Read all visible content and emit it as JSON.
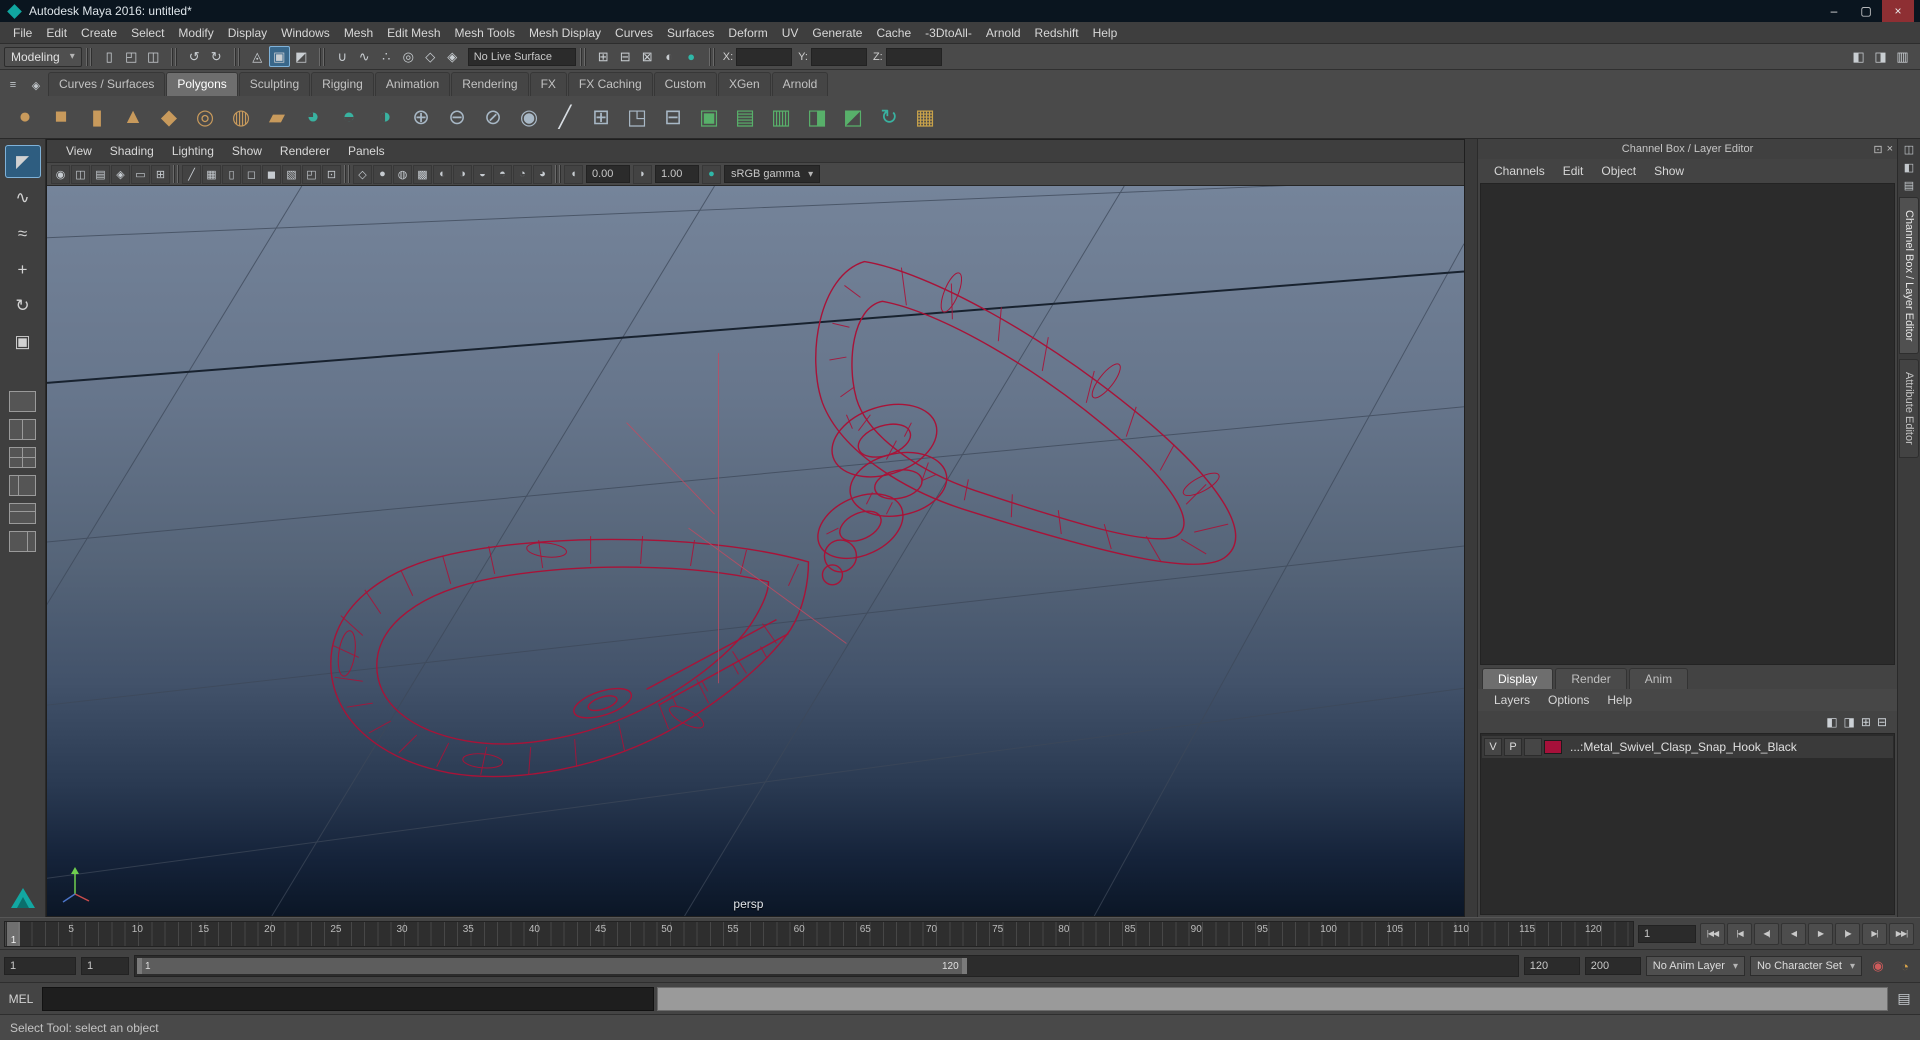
{
  "window": {
    "title": "Autodesk Maya 2016: untitled*",
    "minimize": "–",
    "maximize": "▢",
    "close": "×"
  },
  "menu_bar": {
    "items": [
      "File",
      "Edit",
      "Create",
      "Select",
      "Modify",
      "Display",
      "Windows",
      "Mesh",
      "Edit Mesh",
      "Mesh Tools",
      "Mesh Display",
      "Curves",
      "Surfaces",
      "Deform",
      "UV",
      "Generate",
      "Cache",
      "-3DtoAll-",
      "Arnold",
      "Redshift",
      "Help"
    ]
  },
  "status_line": {
    "mode_selector": "Modeling",
    "live_surface": "No Live Surface",
    "file_icons": [
      {
        "name": "new-scene-icon",
        "glyph": "▯"
      },
      {
        "name": "open-scene-icon",
        "glyph": "◰"
      },
      {
        "name": "save-scene-icon",
        "glyph": "◫"
      }
    ],
    "history_icons": [
      {
        "name": "undo-icon",
        "glyph": "↺"
      },
      {
        "name": "redo-icon",
        "glyph": "↻"
      }
    ],
    "selection_icons": [
      {
        "name": "select-by-hierarchy-icon",
        "glyph": "◬",
        "state": "idle"
      },
      {
        "name": "select-by-object-icon",
        "glyph": "▣",
        "state": "active"
      },
      {
        "name": "select-by-component-icon",
        "glyph": "◩",
        "state": "idle"
      }
    ],
    "snap_icons": [
      {
        "name": "snap-to-grid-icon",
        "glyph": "∪",
        "state": "idle"
      },
      {
        "name": "snap-to-curve-icon",
        "glyph": "∿",
        "state": "idle"
      },
      {
        "name": "snap-to-point-icon",
        "glyph": "∴",
        "state": "idle"
      },
      {
        "name": "snap-to-projected-center-icon",
        "glyph": "◎",
        "state": "idle"
      },
      {
        "name": "snap-to-view-plane-icon",
        "glyph": "◇",
        "state": "idle"
      },
      {
        "name": "make-object-live-icon",
        "glyph": "◈",
        "state": "idle"
      }
    ],
    "render_icons": [
      {
        "name": "open-render-view-icon",
        "glyph": "⊞"
      },
      {
        "name": "render-current-frame-icon",
        "glyph": "⊟"
      },
      {
        "name": "ipr-render-icon",
        "glyph": "⊠"
      },
      {
        "name": "render-settings-icon",
        "glyph": "◐"
      },
      {
        "name": "hypershade-icon",
        "glyph": "●",
        "color": "#2fb8a8"
      }
    ],
    "coord_fields": [
      {
        "label": "X:",
        "value": ""
      },
      {
        "label": "Y:",
        "value": ""
      },
      {
        "label": "Z:",
        "value": ""
      }
    ],
    "sidebar_icons": [
      {
        "name": "show-modeling-toolkit-icon",
        "glyph": "◧"
      },
      {
        "name": "show-hypershade-icon",
        "glyph": "◨"
      },
      {
        "name": "show-attribute-editor-icon",
        "glyph": "▥"
      }
    ]
  },
  "shelf": {
    "side_icons": [
      {
        "name": "shelf-tabs-toggle-icon",
        "glyph": "≡"
      },
      {
        "name": "shelf-menu-icon",
        "glyph": "◈"
      }
    ],
    "tabs": [
      {
        "label": "Curves / Surfaces",
        "state": "idle"
      },
      {
        "label": "Polygons",
        "state": "active"
      },
      {
        "label": "Sculpting",
        "state": "idle"
      },
      {
        "label": "Rigging",
        "state": "idle"
      },
      {
        "label": "Animation",
        "state": "idle"
      },
      {
        "label": "Rendering",
        "state": "idle"
      },
      {
        "label": "FX",
        "state": "idle"
      },
      {
        "label": "FX Caching",
        "state": "idle"
      },
      {
        "label": "Custom",
        "state": "idle"
      },
      {
        "label": "XGen",
        "state": "idle"
      },
      {
        "label": "Arnold",
        "state": "idle"
      }
    ],
    "icons": [
      {
        "name": "poly-sphere-icon",
        "glyph": "●",
        "color": "#c89a5c"
      },
      {
        "name": "poly-cube-icon",
        "glyph": "■",
        "color": "#c89a5c"
      },
      {
        "name": "poly-cylinder-icon",
        "glyph": "▮",
        "color": "#c89a5c"
      },
      {
        "name": "poly-cone-icon",
        "glyph": "▲",
        "color": "#c89a5c"
      },
      {
        "name": "poly-plane-icon",
        "glyph": "◆",
        "color": "#c89a5c"
      },
      {
        "name": "poly-torus-icon",
        "glyph": "◎",
        "color": "#c89a5c"
      },
      {
        "name": "poly-disc-icon",
        "glyph": "◍",
        "color": "#c89a5c"
      },
      {
        "name": "poly-pipe-icon",
        "glyph": "▰",
        "color": "#c89a5c"
      },
      {
        "name": "smooth-mesh-icon",
        "glyph": "◕",
        "color": "#39b2a0"
      },
      {
        "name": "subdiv-proxy-icon",
        "glyph": "◓",
        "color": "#39b2a0"
      },
      {
        "name": "crease-tool-icon",
        "glyph": "◑",
        "color": "#39b2a0"
      },
      {
        "name": "combine-icon",
        "glyph": "⊕",
        "color": "#a8b8c6"
      },
      {
        "name": "separate-icon",
        "glyph": "⊖",
        "color": "#a8b8c6"
      },
      {
        "name": "extract-icon",
        "glyph": "⊘",
        "color": "#a8b8c6"
      },
      {
        "name": "boolean-union-icon",
        "glyph": "◉",
        "color": "#a8b8c6"
      },
      {
        "name": "multi-cut-icon",
        "glyph": "╱",
        "color": "#d8dde2"
      },
      {
        "name": "extrude-icon",
        "glyph": "⊞",
        "color": "#a8b8c6"
      },
      {
        "name": "bevel-icon",
        "glyph": "◳",
        "color": "#a8b8c6"
      },
      {
        "name": "bridge-icon",
        "glyph": "⊟",
        "color": "#a8b8c6"
      },
      {
        "name": "quad-draw-icon",
        "glyph": "▣",
        "color": "#58b06a"
      },
      {
        "name": "target-weld-icon",
        "glyph": "▤",
        "color": "#58b06a"
      },
      {
        "name": "connect-icon",
        "glyph": "▥",
        "color": "#58b06a"
      },
      {
        "name": "mirror-icon",
        "glyph": "◨",
        "color": "#58b06a"
      },
      {
        "name": "sculpt-tool-icon",
        "glyph": "◩",
        "color": "#58b06a"
      },
      {
        "name": "symmetrize-icon",
        "glyph": "↻",
        "color": "#39b2a0"
      },
      {
        "name": "uv-checker-icon",
        "glyph": "▦",
        "color": "#c8a24a"
      }
    ]
  },
  "toolbox": {
    "tools": [
      {
        "name": "select-tool-icon",
        "glyph": "◤",
        "state": "active"
      },
      {
        "name": "lasso-tool-icon",
        "glyph": "∿",
        "state": "idle"
      },
      {
        "name": "paint-select-tool-icon",
        "glyph": "≈",
        "state": "idle"
      },
      {
        "name": "move-tool-icon",
        "glyph": "+",
        "state": "idle"
      },
      {
        "name": "rotate-tool-icon",
        "glyph": "↻",
        "state": "idle"
      },
      {
        "name": "scale-tool-icon",
        "glyph": "▣",
        "state": "idle"
      }
    ],
    "layouts": [
      {
        "name": "single-pane-layout-button",
        "variant": "lo-single"
      },
      {
        "name": "two-pane-layout-button",
        "variant": "lo-two"
      },
      {
        "name": "four-pane-layout-button",
        "variant": "lo-four"
      },
      {
        "name": "persp-outliner-layout-button",
        "variant": "lo-left"
      },
      {
        "name": "persp-graph-layout-button",
        "variant": "lo-top"
      },
      {
        "name": "hypershade-persp-layout-button",
        "variant": "lo-right"
      }
    ]
  },
  "viewport": {
    "menus": [
      "View",
      "Shading",
      "Lighting",
      "Show",
      "Renderer",
      "Panels"
    ],
    "toolbar_group_a": [
      {
        "name": "select-camera-icon",
        "glyph": "◉"
      },
      {
        "name": "lock-camera-icon",
        "glyph": "◫"
      },
      {
        "name": "camera-attributes-icon",
        "glyph": "▤"
      },
      {
        "name": "bookmarks-icon",
        "glyph": "◈"
      },
      {
        "name": "image-plane-icon",
        "glyph": "▭"
      },
      {
        "name": "2d-pan-zoom-icon",
        "glyph": "⊞"
      }
    ],
    "toolbar_group_b": [
      {
        "name": "grease-pencil-icon",
        "glyph": "╱"
      },
      {
        "name": "grid-icon",
        "glyph": "▦"
      },
      {
        "name": "film-gate-icon",
        "glyph": "▯"
      },
      {
        "name": "resolution-gate-icon",
        "glyph": "◻"
      },
      {
        "name": "gate-mask-icon",
        "glyph": "◼"
      },
      {
        "name": "field-chart-icon",
        "glyph": "▧"
      },
      {
        "name": "safe-action-icon",
        "glyph": "◰"
      },
      {
        "name": "safe-title-icon",
        "glyph": "⊡"
      }
    ],
    "toolbar_group_c": [
      {
        "name": "wireframe-icon",
        "glyph": "◇"
      },
      {
        "name": "smooth-shade-all-icon",
        "glyph": "●"
      },
      {
        "name": "wireframe-on-shaded-icon",
        "glyph": "◍"
      },
      {
        "name": "textured-icon",
        "glyph": "▩"
      },
      {
        "name": "use-all-lights-icon",
        "glyph": "◐"
      },
      {
        "name": "shadows-icon",
        "glyph": "◑"
      },
      {
        "name": "screen-space-ao-icon",
        "glyph": "◒"
      },
      {
        "name": "anti-aliasing-icon",
        "glyph": "◓"
      },
      {
        "name": "xray-icon",
        "glyph": "◔"
      },
      {
        "name": "isolate-select-icon",
        "glyph": "◕"
      }
    ],
    "exposure_value": "0.00",
    "gamma_value": "1.00",
    "colorspace": "sRGB gamma",
    "camera_name": "persp",
    "wireframe_color": "#a81338"
  },
  "channel_box": {
    "title": "Channel Box / Layer Editor",
    "header_icons": [
      {
        "name": "pop-out-panel-icon",
        "glyph": "⊡"
      },
      {
        "name": "close-panel-icon",
        "glyph": "×"
      }
    ],
    "menus": [
      "Channels",
      "Edit",
      "Object",
      "Show"
    ],
    "layer_tabs": [
      {
        "label": "Display",
        "state": "active"
      },
      {
        "label": "Render",
        "state": "idle"
      },
      {
        "label": "Anim",
        "state": "idle"
      }
    ],
    "layer_menus": [
      "Layers",
      "Options",
      "Help"
    ],
    "layer_icons": [
      {
        "name": "move-layer-up-icon",
        "glyph": "◧"
      },
      {
        "name": "move-layer-down-icon",
        "glyph": "◨"
      },
      {
        "name": "new-empty-layer-icon",
        "glyph": "⊞"
      },
      {
        "name": "new-layer-from-selected-icon",
        "glyph": "⊟"
      }
    ],
    "layer_row": {
      "visible": "V",
      "playback": "P",
      "color": "#a6103a",
      "name": "...:Metal_Swivel_Clasp_Snap_Hook_Black"
    }
  },
  "side_panel": {
    "icons": [
      {
        "name": "raise-channel-box-icon",
        "glyph": "◫"
      },
      {
        "name": "raise-attribute-editor-icon",
        "glyph": "◧"
      },
      {
        "name": "raise-tool-settings-icon",
        "glyph": "▤"
      }
    ],
    "tabs": [
      {
        "label": "Channel Box / Layer Editor",
        "state": "active"
      },
      {
        "label": "Attribute Editor",
        "state": "idle"
      }
    ]
  },
  "timeline": {
    "ticks": [
      "5",
      "10",
      "15",
      "20",
      "25",
      "30",
      "35",
      "40",
      "45",
      "50",
      "55",
      "60",
      "65",
      "70",
      "75",
      "80",
      "85",
      "90",
      "95",
      "100",
      "105",
      "110",
      "115",
      "120"
    ],
    "current_frame_marker": "1",
    "current_time": "1",
    "playback": [
      {
        "name": "go-to-start-button",
        "glyph": "|◀◀"
      },
      {
        "name": "step-back-frame-button",
        "glyph": "|◀"
      },
      {
        "name": "step-back-key-button",
        "glyph": "◀|"
      },
      {
        "name": "play-backwards-button",
        "glyph": "◀"
      },
      {
        "name": "play-forwards-button",
        "glyph": "▶"
      },
      {
        "name": "step-forward-key-button",
        "glyph": "|▶"
      },
      {
        "name": "step-forward-frame-button",
        "glyph": "▶|"
      },
      {
        "name": "go-to-end-button",
        "glyph": "▶▶|"
      }
    ]
  },
  "range_slider": {
    "animation_start": "1",
    "playback_start": "1",
    "bar_start": "1",
    "bar_end": "120",
    "playback_end": "120",
    "animation_end": "200",
    "anim_layer": "No Anim Layer",
    "character_set": "No Character Set",
    "icons": [
      {
        "name": "auto-keyframe-icon",
        "glyph": "◉",
        "color": "#cf5b5b"
      },
      {
        "name": "animation-preferences-icon",
        "glyph": "◔",
        "color": "#d8a34a"
      }
    ]
  },
  "command_line": {
    "label": "MEL",
    "icon": {
      "name": "script-editor-icon",
      "glyph": "▤"
    }
  },
  "help_line": {
    "text": "Select Tool: select an object"
  }
}
